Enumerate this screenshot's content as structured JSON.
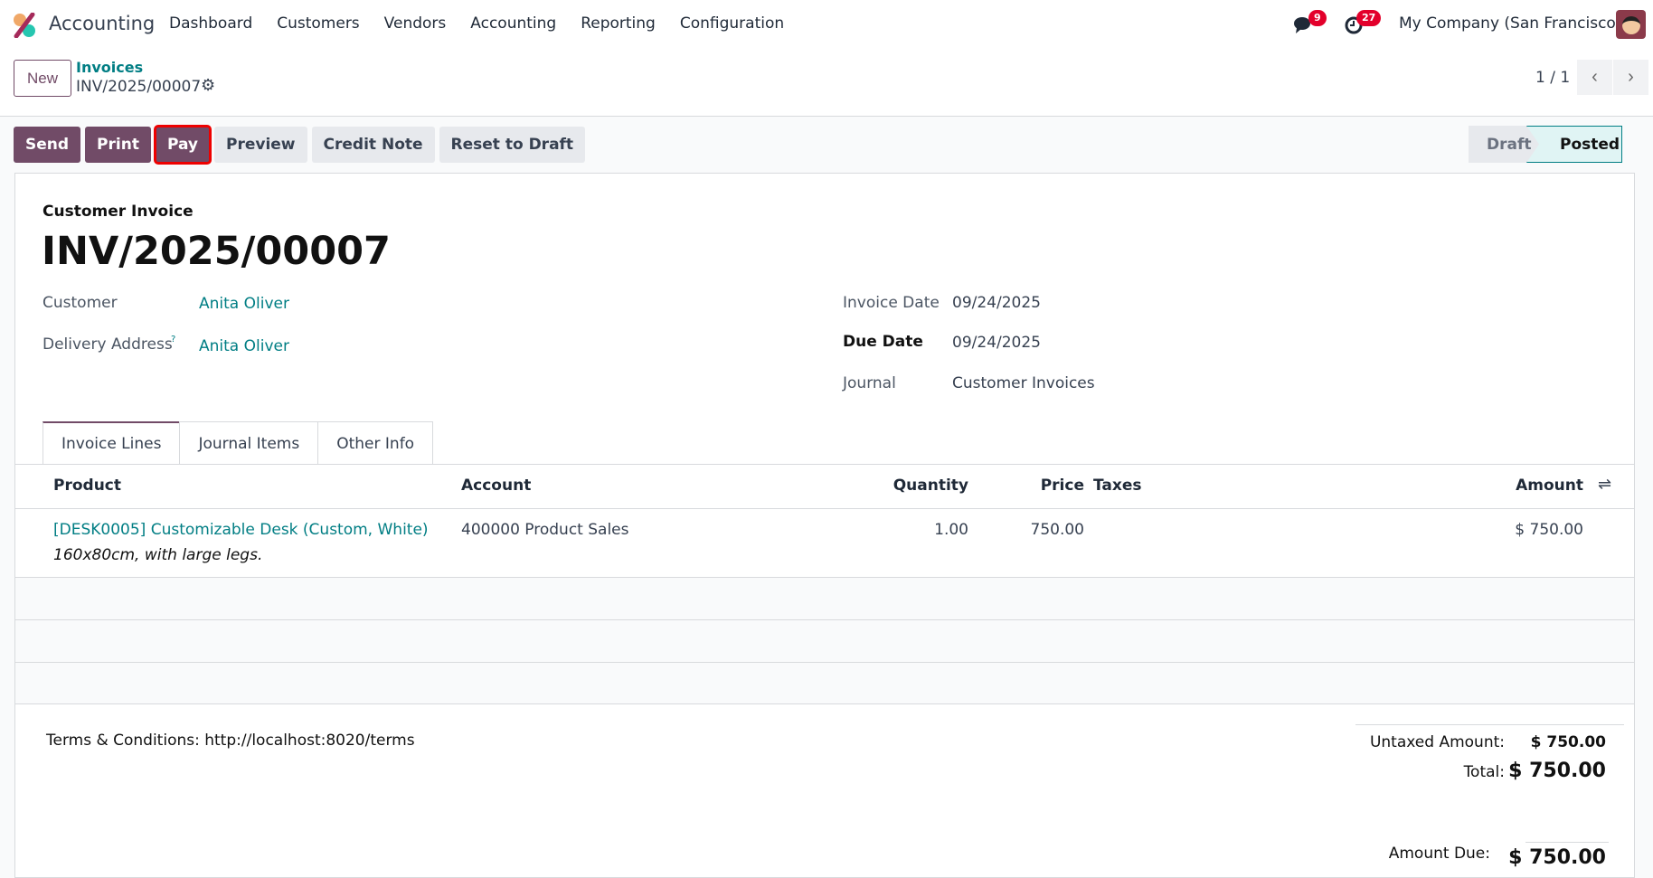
{
  "nav": {
    "app": "Accounting",
    "menu": [
      "Dashboard",
      "Customers",
      "Vendors",
      "Accounting",
      "Reporting",
      "Configuration"
    ],
    "messages_count": "9",
    "activities_count": "27",
    "company": "My Company (San Francisco)"
  },
  "cp": {
    "new": "New",
    "breadcrumb_parent": "Invoices",
    "breadcrumb_current": "INV/2025/00007",
    "pager": "1 / 1"
  },
  "actions": {
    "send": "Send",
    "print": "Print",
    "pay": "Pay",
    "preview": "Preview",
    "credit_note": "Credit Note",
    "reset": "Reset to Draft"
  },
  "status": {
    "draft": "Draft",
    "posted": "Posted"
  },
  "form": {
    "type": "Customer Invoice",
    "name": "INV/2025/00007",
    "customer_label": "Customer",
    "customer": "Anita Oliver",
    "delivery_label": "Delivery Address",
    "delivery_help": "?",
    "delivery": "Anita Oliver",
    "invoice_date_label": "Invoice Date",
    "invoice_date": "09/24/2025",
    "due_date_label": "Due Date",
    "due_date": "09/24/2025",
    "journal_label": "Journal",
    "journal": "Customer Invoices"
  },
  "tabs": [
    "Invoice Lines",
    "Journal Items",
    "Other Info"
  ],
  "table": {
    "headers": {
      "product": "Product",
      "account": "Account",
      "quantity": "Quantity",
      "price": "Price",
      "taxes": "Taxes",
      "amount": "Amount"
    },
    "rows": [
      {
        "product": "[DESK0005] Customizable Desk (Custom, White)",
        "description": "160x80cm, with large legs.",
        "account": "400000 Product Sales",
        "quantity": "1.00",
        "price": "750.00",
        "taxes": "",
        "amount": "$ 750.00"
      }
    ]
  },
  "footer": {
    "terms": "Terms & Conditions: http://localhost:8020/terms",
    "untaxed_label": "Untaxed Amount:",
    "untaxed": "$ 750.00",
    "total_label": "Total:",
    "total": "$ 750.00",
    "due_label": "Amount Due:",
    "due": "$ 750.00"
  }
}
